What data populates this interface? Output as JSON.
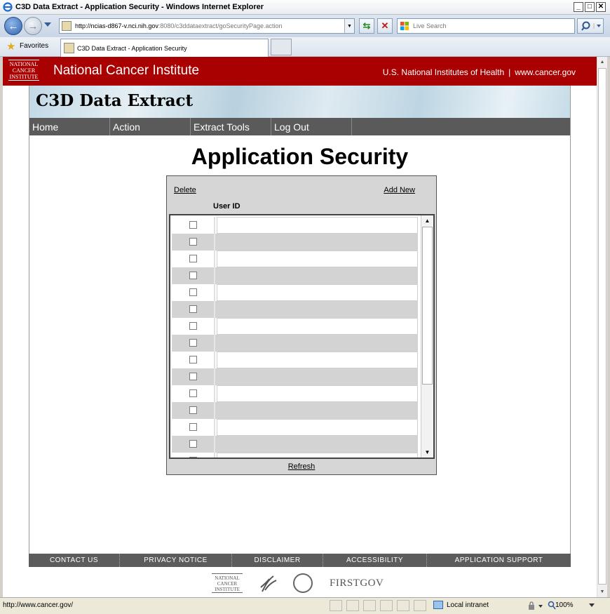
{
  "browser": {
    "window_title": "C3D Data Extract - Application Security - Windows Internet Explorer",
    "address_url_host": "http://ncias-d867-v.nci.nih.gov",
    "address_url_path": ":8080/c3ddataextract/goSecurityPage.action",
    "search_placeholder": "Live Search",
    "favorites_label": "Favorites",
    "tab_title": "C3D Data Extract - Application Security",
    "status_url": "http://www.cancer.gov/",
    "zone": "Local intranet",
    "zoom": "100%"
  },
  "nci": {
    "logo_lines": [
      "NATIONAL",
      "CANCER",
      "INSTITUTE"
    ],
    "name": "National Cancer Institute",
    "nih_link": "U.S. National Institutes of Health",
    "sep": "|",
    "cancer_link": "www.cancer.gov"
  },
  "app": {
    "title": "C3D Data Extract",
    "menu": [
      "Home",
      "Action",
      "Extract Tools",
      "Log Out"
    ],
    "page_title": "Application Security",
    "delete_label": "Delete",
    "add_new_label": "Add New",
    "col_header": "User ID",
    "refresh_label": "Refresh"
  },
  "footer": {
    "links": [
      "CONTACT US",
      "PRIVACY NOTICE",
      "DISCLAIMER",
      "ACCESSIBILITY",
      "APPLICATION SUPPORT"
    ],
    "logo_nci_lines": [
      "NATIONAL",
      "CANCER",
      "INSTITUTE"
    ],
    "logo_firstgov": "FIRSTGOV"
  },
  "colors": {
    "nci_red": "#a90101",
    "menu_grey": "#5a5a5a",
    "panel_grey": "#d6d6d6"
  }
}
